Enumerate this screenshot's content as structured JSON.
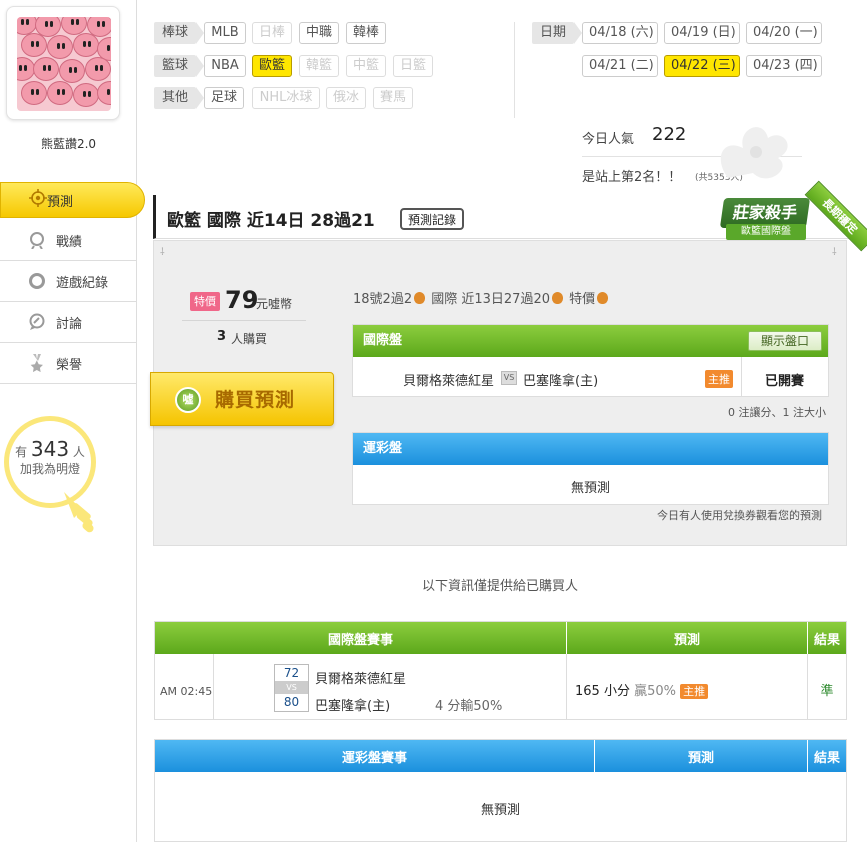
{
  "user": {
    "name": "熊藍讚2.0"
  },
  "nav": [
    {
      "label": "預測",
      "icon": "target-icon",
      "active": true
    },
    {
      "label": "戰績",
      "icon": "trophy-icon",
      "active": false
    },
    {
      "label": "遊戲紀錄",
      "icon": "ring-icon",
      "active": false
    },
    {
      "label": "討論",
      "icon": "chat-icon",
      "active": false
    },
    {
      "label": "榮譽",
      "icon": "medal-icon",
      "active": false
    }
  ],
  "fans": {
    "prefix": "有",
    "count": "343",
    "unit": "人",
    "text": "加我為明燈"
  },
  "filters": {
    "rows": [
      {
        "category": "棒球",
        "items": [
          {
            "label": "MLB",
            "state": "normal"
          },
          {
            "label": "日棒",
            "state": "disabled"
          },
          {
            "label": "中職",
            "state": "normal"
          },
          {
            "label": "韓棒",
            "state": "normal"
          }
        ]
      },
      {
        "category": "籃球",
        "items": [
          {
            "label": "NBA",
            "state": "normal"
          },
          {
            "label": "歐籃",
            "state": "selected"
          },
          {
            "label": "韓籃",
            "state": "disabled"
          },
          {
            "label": "中籃",
            "state": "disabled"
          },
          {
            "label": "日籃",
            "state": "disabled"
          }
        ]
      },
      {
        "category": "其他",
        "items": [
          {
            "label": "足球",
            "state": "normal"
          },
          {
            "label": "NHL冰球",
            "state": "disabled"
          },
          {
            "label": "俄冰",
            "state": "disabled"
          },
          {
            "label": "賽馬",
            "state": "disabled"
          }
        ]
      }
    ]
  },
  "dates": {
    "label": "日期",
    "items": [
      {
        "label": "04/18 (六)",
        "selected": false
      },
      {
        "label": "04/19 (日)",
        "selected": false
      },
      {
        "label": "04/20 (一)",
        "selected": false
      },
      {
        "label": "04/21 (二)",
        "selected": false
      },
      {
        "label": "04/22 (三)",
        "selected": true
      },
      {
        "label": "04/23 (四)",
        "selected": false
      }
    ]
  },
  "popularity": {
    "label": "今日人氣",
    "count": "222",
    "rank_text": "是站上第2名！！",
    "total": "(共5353人)"
  },
  "badge": {
    "title": "莊家殺手",
    "subtitle": "歐籃國際盤",
    "ribbon": "長期穩定"
  },
  "header": {
    "title": "歐籃 國際 近14日 28過21",
    "history_button": "預測記錄"
  },
  "offer": {
    "tag": "特價",
    "price": "79",
    "currency": "元噓幣",
    "buyers": "3",
    "buyers_unit": "人購買",
    "buy_button": "購買預測",
    "buy_icon": "噓"
  },
  "summary": {
    "part1": "18號2過2",
    "part2": "國際 近13日27過20",
    "part3": "特價"
  },
  "intl": {
    "header": "國際盤",
    "show_button": "顯示盤口",
    "team_away": "貝爾格萊德紅星",
    "vs": "VS",
    "team_home": "巴塞隆拿(主)",
    "tag": "主推",
    "status": "已開賽",
    "note": "0 注讓分、1 注大小"
  },
  "lottery": {
    "header": "運彩盤",
    "empty": "無預測",
    "note": "今日有人使用兌換券觀看您的預測"
  },
  "info_text": "以下資訊僅提供給已購買人",
  "intl_table": {
    "headers": [
      "國際盤賽事",
      "預測",
      "結果"
    ],
    "row": {
      "time": "AM 02:45",
      "score_away": "72",
      "vs": "VS",
      "score_home": "80",
      "team_away": "貝爾格萊德紅星",
      "team_home": "巴塞隆拿(主)",
      "spread": "4 分輸50%",
      "pred_value": "165",
      "pred_label": "小分",
      "pred_rate": "贏50%",
      "pred_tag": "主推",
      "result": "準"
    }
  },
  "lottery_table": {
    "headers": [
      "運彩盤賽事",
      "預測",
      "結果"
    ],
    "empty": "無預測"
  },
  "colors": {
    "accent_yellow": "#ffe600",
    "green": "#6cb52a",
    "blue": "#1b90dd",
    "orange": "#f28a2e"
  }
}
